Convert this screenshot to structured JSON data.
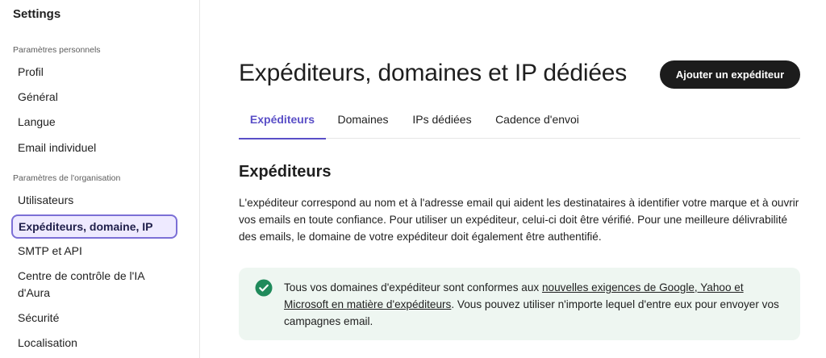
{
  "sidebar": {
    "title": "Settings",
    "personal_section": {
      "label": "Paramètres personnels",
      "items": [
        "Profil",
        "Général",
        "Langue",
        "Email individuel"
      ]
    },
    "org_section": {
      "label": "Paramètres de l'organisation",
      "items": [
        "Utilisateurs",
        "Expéditeurs, domaine, IP",
        "SMTP et API",
        "Centre de contrôle de l'IA d'Aura",
        "Sécurité",
        "Localisation"
      ],
      "active_item": "Expéditeurs, domaine, IP"
    }
  },
  "header": {
    "title": "Expéditeurs, domaines et IP dédiées",
    "add_button_label": "Ajouter un expéditeur"
  },
  "tabs": [
    {
      "label": "Expéditeurs",
      "active": true
    },
    {
      "label": "Domaines",
      "active": false
    },
    {
      "label": "IPs dédiées",
      "active": false
    },
    {
      "label": "Cadence d'envoi",
      "active": false
    }
  ],
  "section": {
    "title": "Expéditeurs",
    "description": "L'expéditeur correspond au nom et à l'adresse email qui aident les destinataires à identifier votre marque et à ouvrir vos emails en toute confiance. Pour utiliser un expéditeur, celui-ci doit être vérifié. Pour une meilleure délivrabilité des emails, le domaine de votre expéditeur doit également être authentifié."
  },
  "alert": {
    "icon": "check-circle-icon",
    "text_before": "Tous vos domaines d'expéditeur sont conformes aux ",
    "link_text": "nouvelles exigences de Google, Yahoo et Microsoft en matière d'expéditeurs",
    "text_after": ". Vous pouvez utiliser n'importe lequel d'entre eux pour envoyer vos campagnes email."
  },
  "colors": {
    "accent": "#5a4fc7",
    "active_nav_bg": "#eeeaff",
    "active_nav_border": "#7b6fd6",
    "success": "#1f8a5b",
    "alert_bg": "#eef6f1",
    "button_bg": "#1c1c1c"
  }
}
